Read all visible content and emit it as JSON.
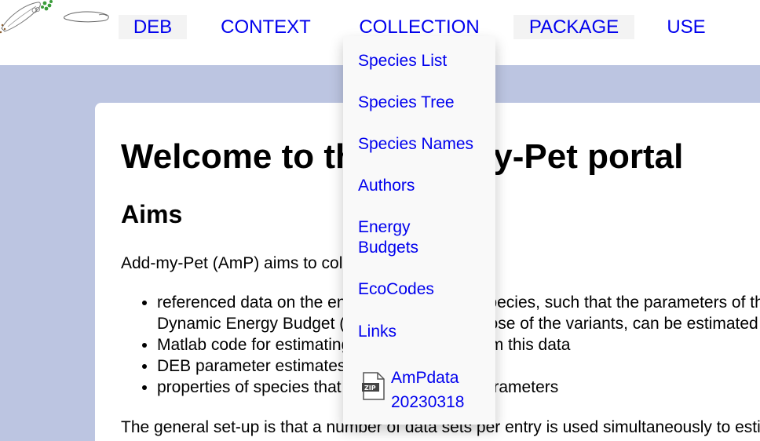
{
  "nav": {
    "items": [
      {
        "label": "DEB"
      },
      {
        "label": "CONTEXT"
      },
      {
        "label": "COLLECTION"
      },
      {
        "label": "PACKAGE"
      },
      {
        "label": "USE"
      }
    ]
  },
  "dropdown": {
    "items": [
      {
        "label": "Species List"
      },
      {
        "label": "Species Tree"
      },
      {
        "label": "Species Names"
      },
      {
        "label": "Authors"
      },
      {
        "label": "Energy Budgets"
      },
      {
        "label": "EcoCodes"
      },
      {
        "label": "Links"
      }
    ],
    "zip": {
      "icon": "zip-file-icon",
      "line1": "AmPdata",
      "line2": "20230318"
    }
  },
  "content": {
    "title": "Welcome to the Add-my-Pet portal",
    "aims_heading": "Aims",
    "intro": "Add-my-Pet (AmP) aims to collect",
    "bullets": [
      "referenced data on the energetics of animal species, such that the parameters of the Dynamic Energy Budget (DEB) model, and those of the variants, can be estimated",
      "Matlab code for estimating the parameters from this data",
      "DEB parameter estimates",
      "properties of species that follow from these parameters"
    ],
    "para": "The general set-up is that a number of data sets per entry is used simultaneously to estimate all parameters,"
  },
  "colors": {
    "link": "#0000ee",
    "band": "#bcc5e1",
    "dropdown_bg": "#f9f9f9",
    "nav_shade": "#f3f3f3"
  }
}
